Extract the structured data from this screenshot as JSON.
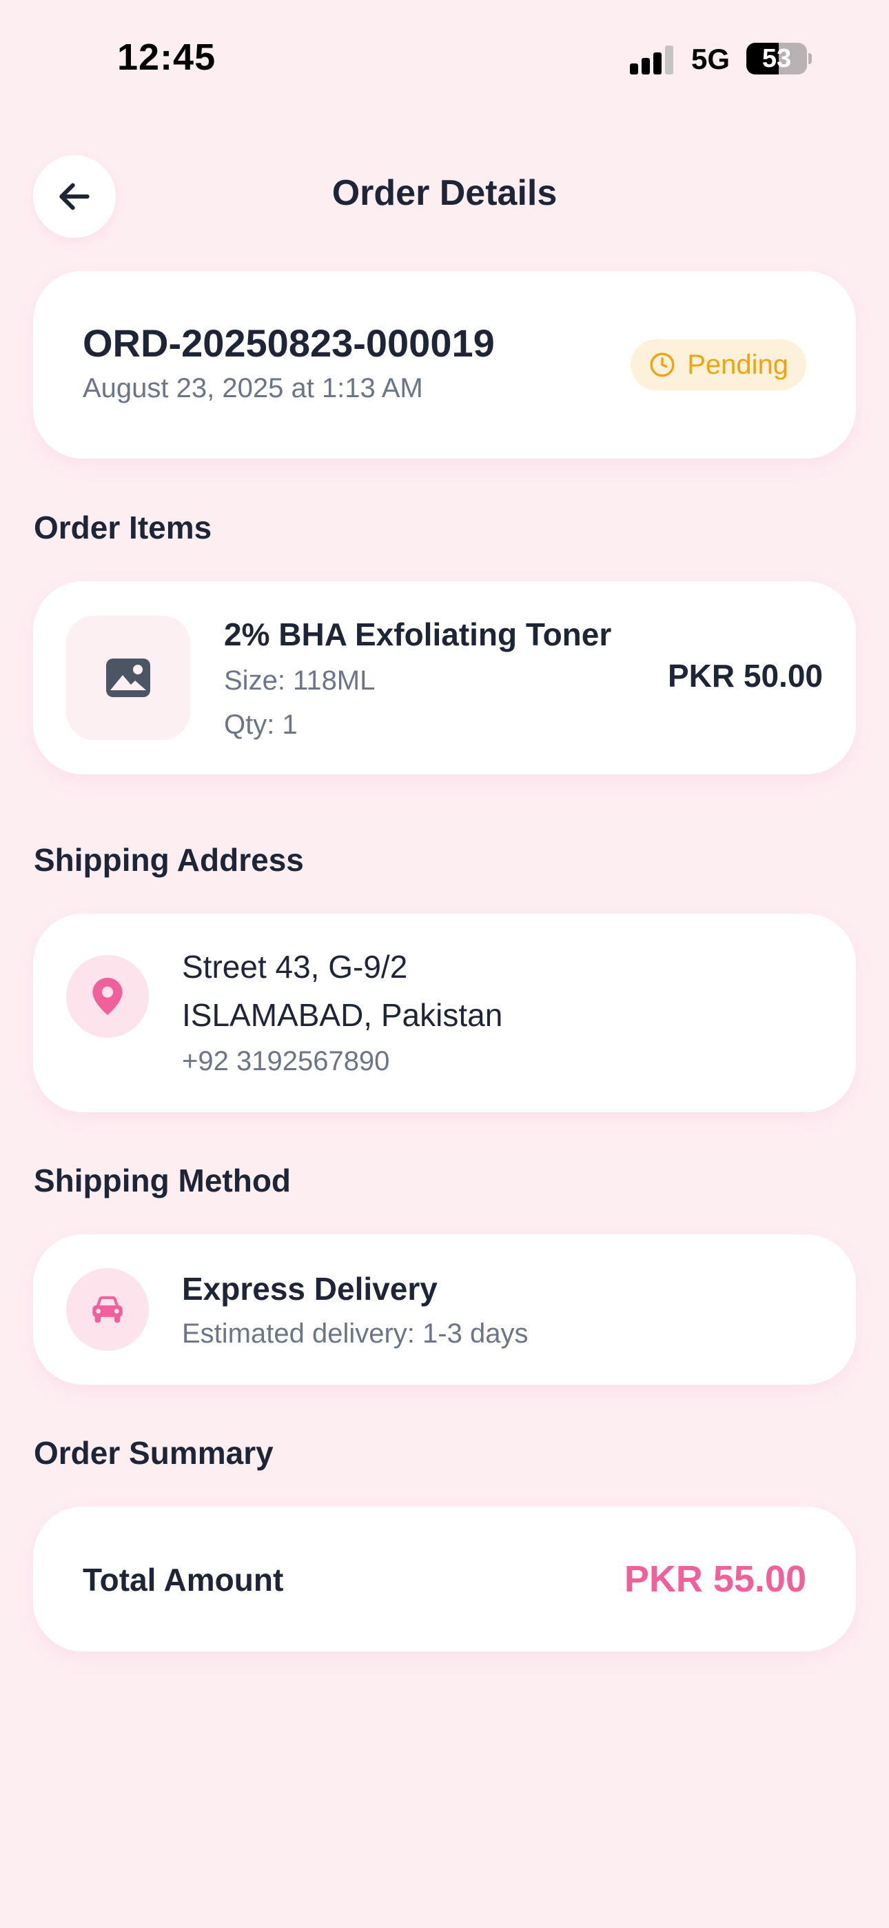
{
  "status_bar": {
    "time": "12:45",
    "network": "5G",
    "battery_level": "53",
    "battery_fraction": 0.53
  },
  "header": {
    "title": "Order Details",
    "back_icon": "arrow-left-icon"
  },
  "order": {
    "number": "ORD-20250823-000019",
    "date": "August 23, 2025 at 1:13 AM",
    "status": "Pending",
    "status_icon": "clock-icon",
    "status_color": "#f0a30a"
  },
  "items_section": {
    "title": "Order Items",
    "items": [
      {
        "name": "2% BHA Exfoliating Toner",
        "size": "Size: 118ML",
        "qty": "Qty: 1",
        "price": "PKR 50.00",
        "thumb_icon": "image-placeholder-icon"
      }
    ]
  },
  "shipping_address": {
    "title": "Shipping Address",
    "icon": "map-pin-icon",
    "line1": "Street 43, G-9/2",
    "line2": "ISLAMABAD, Pakistan",
    "phone": "+92 3192567890"
  },
  "shipping_method": {
    "title": "Shipping Method",
    "icon": "car-icon",
    "name": "Express Delivery",
    "eta": "Estimated delivery: 1-3 days"
  },
  "summary": {
    "title": "Order Summary",
    "total_label": "Total Amount",
    "total_value": "PKR 55.00",
    "accent_color": "#f0609a"
  }
}
